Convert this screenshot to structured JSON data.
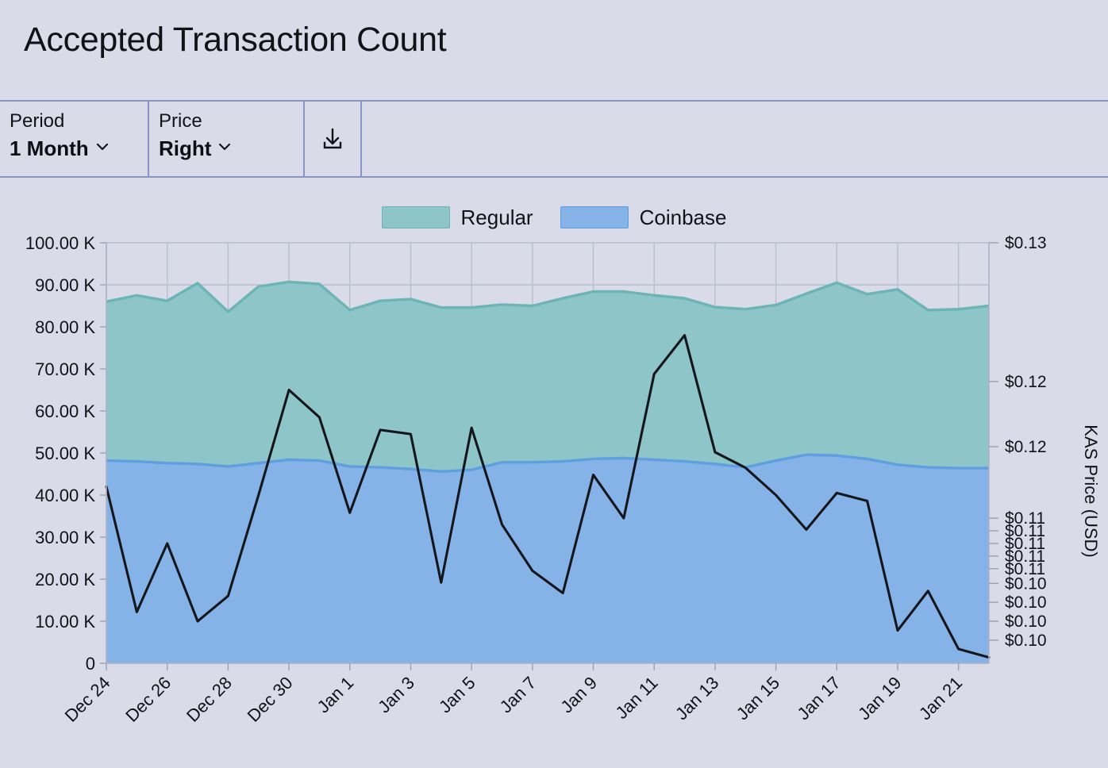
{
  "header": {
    "title": "Accepted Transaction Count"
  },
  "toolbar": {
    "period": {
      "label": "Period",
      "value": "1 Month",
      "chevron_icon": "chevron-down-icon"
    },
    "price": {
      "label": "Price",
      "value": "Right",
      "chevron_icon": "chevron-down-icon"
    },
    "download": {
      "icon": "download-icon"
    }
  },
  "legend": [
    {
      "label": "Regular",
      "color": "#8dc5c8"
    },
    {
      "label": "Coinbase",
      "color": "#85b3e8"
    }
  ],
  "colors": {
    "background": "#d9dce8",
    "border": "#8b93c4",
    "regular_area": "#8dc5c8",
    "regular_stroke": "#6cb4b6",
    "coinbase_area": "#85b3e8",
    "coinbase_stroke": "#5f9fe0",
    "price_line": "#14161c",
    "grid": "#b9bdcc"
  },
  "chart_data": {
    "type": "area",
    "title": "Accepted Transaction Count",
    "xlabel": "",
    "ylabel": "",
    "ylabel_right": "KAS Price (USD)",
    "grid": true,
    "legend_position": "top-center",
    "stacked": true,
    "ylim": [
      0,
      100000
    ],
    "ytick_labels": [
      "100.00 K",
      "90.00 K",
      "80.00 K",
      "70.00 K",
      "60.00 K",
      "50.00 K",
      "40.00 K",
      "30.00 K",
      "20.00 K",
      "10.00 K",
      "0"
    ],
    "ytick_values": [
      100000,
      90000,
      80000,
      70000,
      60000,
      50000,
      40000,
      30000,
      20000,
      10000,
      0
    ],
    "ytick_labels_right": [
      "$0.13",
      "$0.12",
      "$0.12",
      "$0.11",
      "$0.11",
      "$0.11",
      "$0.11",
      "$0.11",
      "$0.10",
      "$0.10",
      "$0.10",
      "$0.10"
    ],
    "ytick_right_positions": [
      100000,
      67000,
      51500,
      34500,
      31500,
      28500,
      25500,
      22500,
      19000,
      14500,
      10000,
      5500
    ],
    "x": [
      "Dec 24",
      "Dec 25",
      "Dec 26",
      "Dec 27",
      "Dec 28",
      "Dec 29",
      "Dec 30",
      "Dec 31",
      "Jan 1",
      "Jan 2",
      "Jan 3",
      "Jan 4",
      "Jan 5",
      "Jan 6",
      "Jan 7",
      "Jan 8",
      "Jan 9",
      "Jan 10",
      "Jan 11",
      "Jan 12",
      "Jan 13",
      "Jan 14",
      "Jan 15",
      "Jan 16",
      "Jan 17",
      "Jan 18",
      "Jan 19",
      "Jan 20",
      "Jan 21",
      "Jan 22"
    ],
    "xtick_labels": [
      "Dec 24",
      "Dec 26",
      "Dec 28",
      "Dec 30",
      "Jan 1",
      "Jan 3",
      "Jan 5",
      "Jan 7",
      "Jan 9",
      "Jan 11",
      "Jan 13",
      "Jan 15",
      "Jan 17",
      "Jan 19",
      "Jan 21"
    ],
    "xtick_indices": [
      0,
      2,
      4,
      6,
      8,
      10,
      12,
      14,
      16,
      18,
      20,
      22,
      24,
      26,
      28
    ],
    "xtick_rotation": -45,
    "series": [
      {
        "name": "Coinbase",
        "values": [
          48200,
          48000,
          47600,
          47400,
          46800,
          47600,
          48400,
          48200,
          46800,
          46600,
          46200,
          45600,
          46000,
          47800,
          47800,
          48000,
          48600,
          48800,
          48400,
          48000,
          47400,
          46600,
          48200,
          49600,
          49400,
          48600,
          47200,
          46600,
          46400,
          46400
        ]
      },
      {
        "name": "Regular",
        "values": [
          37800,
          39500,
          38600,
          43000,
          36800,
          42000,
          42300,
          42000,
          37200,
          39600,
          40400,
          39000,
          38600,
          37500,
          37200,
          38800,
          39800,
          39600,
          39100,
          38800,
          37300,
          37600,
          37000,
          38300,
          41100,
          39200,
          41700,
          37400,
          37800,
          38600
        ]
      }
    ],
    "total_top": [
      86000,
      87500,
      86200,
      90400,
      83600,
      89600,
      90700,
      90200,
      84000,
      86200,
      86600,
      84600,
      84600,
      85300,
      85000,
      86800,
      88400,
      88400,
      87500,
      86800,
      84700,
      84200,
      85200,
      87900,
      90500,
      87800,
      88900,
      84000,
      84200,
      85000
    ],
    "price_line": {
      "name": "KAS Price (USD)",
      "axis": "right",
      "color": "#14161c",
      "values_scaled_to_left_axis": [
        42000,
        12200,
        28500,
        10000,
        16000,
        40000,
        65000,
        58500,
        35800,
        55500,
        54500,
        19200,
        56000,
        33000,
        22000,
        16700,
        44800,
        34500,
        68800,
        78000,
        50200,
        46500,
        40000,
        31800,
        40500,
        38600,
        7800,
        17200,
        3400,
        1400
      ]
    }
  }
}
